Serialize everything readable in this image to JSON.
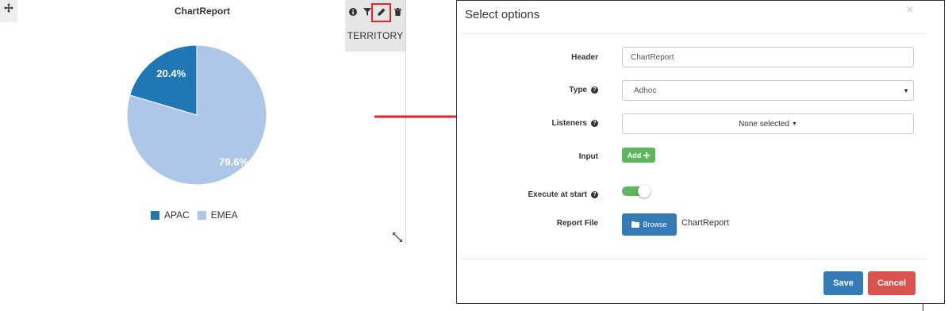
{
  "widget": {
    "title": "ChartReport",
    "territory_label": "TERRITORY",
    "tool_icons": [
      "info-icon",
      "filter-icon",
      "pencil-icon",
      "trash-icon"
    ],
    "highlight_color": "#e0242b"
  },
  "chart_data": {
    "type": "pie",
    "categories": [
      "APAC",
      "EMEA"
    ],
    "values": [
      20.4,
      79.6
    ],
    "value_labels": [
      "20.4%",
      "79.6%"
    ],
    "colors": [
      "#1f77b4",
      "#aec7e8"
    ],
    "title": "ChartReport",
    "legend_position": "bottom"
  },
  "modal": {
    "title": "Select options",
    "close_label": "×",
    "fields": {
      "header_label": "Header",
      "header_value": "ChartReport",
      "type_label": "Type",
      "type_value": "Adhoc",
      "listeners_label": "Listeners",
      "listeners_value": "None selected",
      "input_label": "Input",
      "add_label": "Add",
      "execute_label": "Execute at start",
      "execute_checked": true,
      "report_file_label": "Report File",
      "browse_label": "Browse",
      "report_file_value": "ChartReport"
    },
    "save_label": "Save",
    "cancel_label": "Cancel",
    "colors": {
      "primary": "#337ab7",
      "success": "#5cb85c",
      "danger": "#d9534f"
    }
  }
}
